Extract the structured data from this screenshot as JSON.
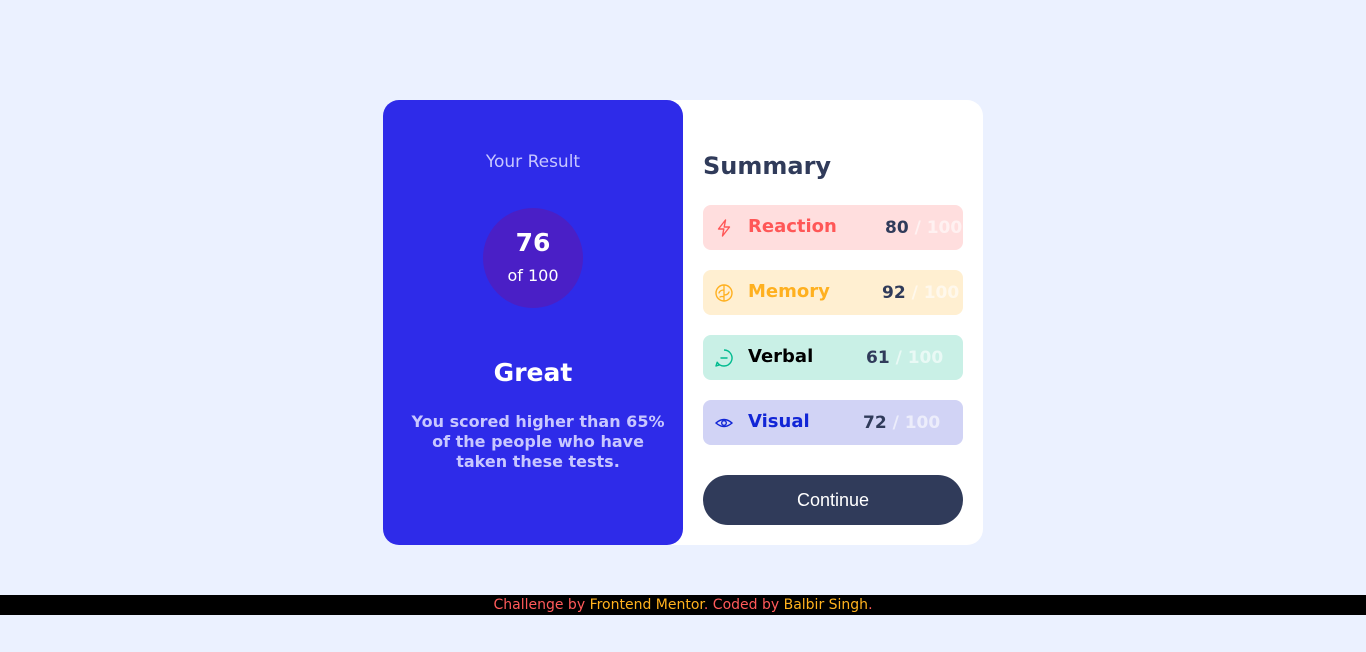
{
  "result": {
    "heading": "Your Result",
    "score": "76",
    "score_of": "of 100",
    "rating": "Great",
    "description": "You scored higher than 65% of the people who have taken these tests."
  },
  "summary": {
    "title": "Summary",
    "items": [
      {
        "label": "Reaction",
        "score": "80",
        "max": "/ 100",
        "icon": "lightning-icon",
        "color": "#ff5757",
        "bg": "#ffdede"
      },
      {
        "label": "Memory",
        "score": "92",
        "max": "/ 100",
        "icon": "brain-icon",
        "color": "#ffb01f",
        "bg": "#ffefd1"
      },
      {
        "label": "Verbal",
        "score": "61",
        "max": "/ 100",
        "icon": "chat-icon",
        "color": "#000000",
        "bg": "#c9f0e6"
      },
      {
        "label": "Visual",
        "score": "72",
        "max": "/ 100",
        "icon": "eye-icon",
        "color": "#1125d6",
        "bg": "#d1d3f5"
      }
    ],
    "continue_label": "Continue"
  },
  "footer": {
    "prefix": "Challenge by ",
    "link1": "Frontend Mentor",
    "middle": ". Coded by ",
    "link2": "Balbir Singh",
    "suffix": "."
  },
  "colors": {
    "page_bg": "#ebf1ff",
    "result_bg": "#2e2be9",
    "circle_bg": "#4a1fc6",
    "dark_slate": "#303b5a",
    "footer_text": "#ff5a5a",
    "footer_link": "#ffb21e"
  }
}
